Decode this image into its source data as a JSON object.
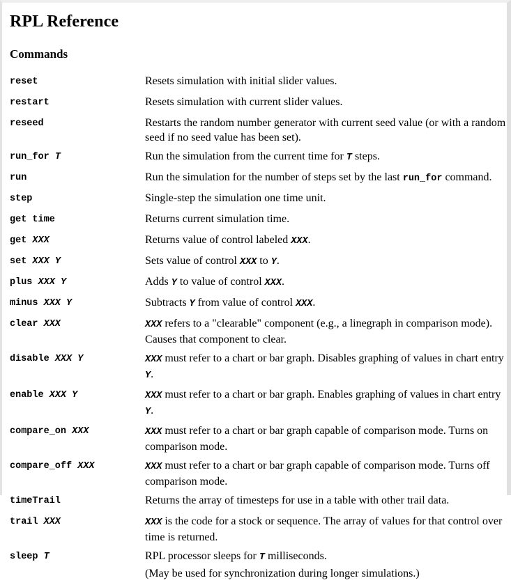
{
  "document": {
    "title": "RPL Reference",
    "section_heading": "Commands"
  },
  "commands": [
    {
      "name": "reset",
      "syntax": "reset",
      "params": [],
      "description": "Resets simulation with initial slider values."
    },
    {
      "name": "restart",
      "syntax": "restart",
      "params": [],
      "description": "Resets simulation with current slider values."
    },
    {
      "name": "reseed",
      "syntax": "reseed",
      "params": [],
      "description": "Restarts the random number generator with current seed value (or with a random seed if no seed value has been set)."
    },
    {
      "name": "run_for",
      "syntax": "run_for T",
      "params": [
        "T"
      ],
      "description": "Run the simulation from the current time for T steps."
    },
    {
      "name": "run",
      "syntax": "run",
      "params": [],
      "description": "Run the simulation for the number of steps set by the last run_for command."
    },
    {
      "name": "step",
      "syntax": "step",
      "params": [],
      "description": "Single-step the simulation one time unit."
    },
    {
      "name": "get time",
      "syntax": "get time",
      "params": [],
      "description": "Returns current simulation time."
    },
    {
      "name": "get",
      "syntax": "get XXX",
      "params": [
        "XXX"
      ],
      "description": "Returns value of control labeled XXX."
    },
    {
      "name": "set",
      "syntax": "set XXX Y",
      "params": [
        "XXX",
        "Y"
      ],
      "description": "Sets value of control XXX to Y."
    },
    {
      "name": "plus",
      "syntax": "plus XXX Y",
      "params": [
        "XXX",
        "Y"
      ],
      "description": "Adds Y to value of control XXX."
    },
    {
      "name": "minus",
      "syntax": "minus XXX Y",
      "params": [
        "XXX",
        "Y"
      ],
      "description": "Subtracts Y from value of control XXX."
    },
    {
      "name": "clear",
      "syntax": "clear XXX",
      "params": [
        "XXX"
      ],
      "description": "XXX refers to a \"clearable\" component (e.g., a linegraph in comparison mode). Causes that component to clear."
    },
    {
      "name": "disable",
      "syntax": "disable XXX Y",
      "params": [
        "XXX",
        "Y"
      ],
      "description": "XXX must refer to a chart or bar graph. Disables graphing of values in chart entry Y."
    },
    {
      "name": "enable",
      "syntax": "enable XXX Y",
      "params": [
        "XXX",
        "Y"
      ],
      "description": "XXX must refer to a chart or bar graph. Enables graphing of values in chart entry Y."
    },
    {
      "name": "compare_on",
      "syntax": "compare_on XXX",
      "params": [
        "XXX"
      ],
      "description": "XXX must refer to a chart or bar graph capable of comparison mode. Turns on comparison mode."
    },
    {
      "name": "compare_off",
      "syntax": "compare_off XXX",
      "params": [
        "XXX"
      ],
      "description": "XXX must refer to a chart or bar graph capable of comparison mode. Turns off comparison mode."
    },
    {
      "name": "timeTrail",
      "syntax": "timeTrail",
      "params": [],
      "description": "Returns the array of timesteps for use in a table with other trail data."
    },
    {
      "name": "trail",
      "syntax": "trail XXX",
      "params": [
        "XXX"
      ],
      "description": "XXX is the code for a stock or sequence. The array of values for that control over time is returned."
    },
    {
      "name": "sleep",
      "syntax": "sleep T",
      "params": [
        "T"
      ],
      "description": "RPL processor sleeps for T milliseconds.",
      "note": "(May be used for synchronization during longer simulations.)"
    }
  ],
  "fragments": {
    "reset_desc": "Resets simulation with initial slider values.",
    "restart_desc": "Resets simulation with current slider values.",
    "reseed_desc": "Restarts the random number generator with current seed value (or with a random seed if no seed value has been set).",
    "run_for_desc_a": "Run the simulation from the current time for ",
    "run_for_param_T": "T",
    "run_for_desc_b": " steps.",
    "run_desc_a": "Run the simulation for the number of steps set by the last ",
    "run_desc_cmdref": "run_for",
    "run_desc_b": " command.",
    "step_desc": "Single-step the simulation one time unit.",
    "get_time_desc": "Returns current simulation time.",
    "get_desc_a": "Returns value of control labeled ",
    "get_param_XXX": "XXX",
    "get_desc_b": ".",
    "set_desc_a": "Sets value of control ",
    "set_param_XXX": "XXX",
    "set_desc_b": " to ",
    "set_param_Y": "Y",
    "set_desc_c": ".",
    "plus_desc_a": "Adds ",
    "plus_param_Y": "Y",
    "plus_desc_b": " to value of control ",
    "plus_param_XXX": "XXX",
    "plus_desc_c": ".",
    "minus_desc_a": "Subtracts ",
    "minus_param_Y": "Y",
    "minus_desc_b": " from value of control ",
    "minus_param_XXX": "XXX",
    "minus_desc_c": ".",
    "clear_param_XXX": "XXX",
    "clear_desc": " refers to a \"clearable\" component (e.g., a linegraph in comparison mode). Causes that component to clear.",
    "disable_param_XXX": "XXX",
    "disable_desc_a": " must refer to a chart or bar graph. Disables graphing of values in chart entry ",
    "disable_param_Y": "Y",
    "disable_desc_b": ".",
    "enable_param_XXX": "XXX",
    "enable_desc_a": " must refer to a chart or bar graph. Enables graphing of values in chart entry ",
    "enable_param_Y": "Y",
    "enable_desc_b": ".",
    "compare_on_param_XXX": "XXX",
    "compare_on_desc": " must refer to a chart or bar graph capable of comparison mode. Turns on comparison mode.",
    "compare_off_param_XXX": "XXX",
    "compare_off_desc": " must refer to a chart or bar graph capable of comparison mode. Turns off comparison mode.",
    "timeTrail_desc": "Returns the array of timesteps for use in a table with other trail data.",
    "trail_param_XXX": "XXX",
    "trail_desc": " is the code for a stock or sequence. The array of values for that control over time is returned.",
    "sleep_desc_a": "RPL processor sleeps for ",
    "sleep_param_T": "T",
    "sleep_desc_b": " milliseconds.",
    "sleep_note": "(May be used for synchronization during longer simulations.)"
  },
  "syntax_tokens": {
    "reset": "reset",
    "restart": "restart",
    "reseed": "reseed",
    "run_for_cmd": "run_for ",
    "run_for_T": "T",
    "run": "run",
    "step": "step",
    "get_time": "get time",
    "get_cmd": "get ",
    "get_XXX": "XXX",
    "set_cmd": "set ",
    "set_XXX": "XXX",
    "set_Y": "Y",
    "plus_cmd": "plus ",
    "plus_XXX": "XXX",
    "plus_Y": "Y",
    "minus_cmd": "minus ",
    "minus_XXX": "XXX",
    "minus_Y": "Y",
    "clear_cmd": "clear ",
    "clear_XXX": "XXX",
    "disable_cmd": "disable ",
    "disable_XXX": "XXX",
    "disable_Y": "Y",
    "enable_cmd": "enable ",
    "enable_XXX": "XXX",
    "enable_Y": "Y",
    "compare_on_cmd": "compare_on ",
    "compare_on_XXX": "XXX",
    "compare_off_cmd": "compare_off ",
    "compare_off_XXX": "XXX",
    "timeTrail": "timeTrail",
    "trail_cmd": "trail ",
    "trail_XXX": "XXX",
    "sleep_cmd": "sleep ",
    "sleep_T": "T"
  },
  "colors": {
    "text": "#000000",
    "background": "#ffffff",
    "page_border": "#e3e3e3"
  }
}
